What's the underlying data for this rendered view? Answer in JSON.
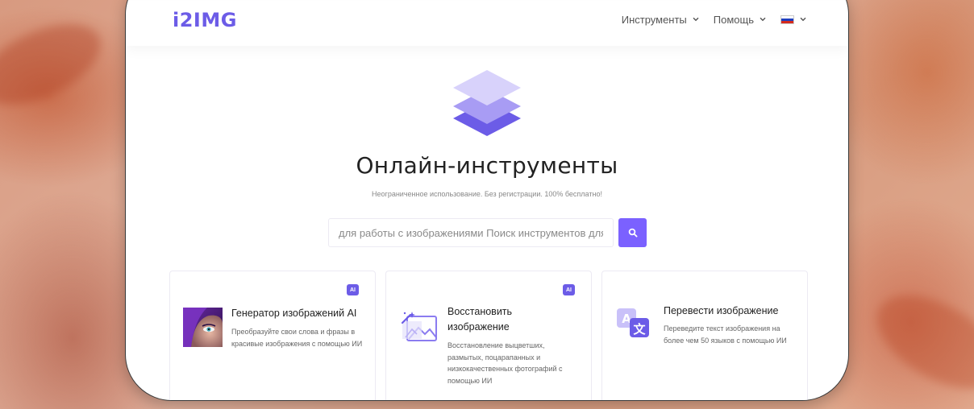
{
  "header": {
    "logo": "i2IMG",
    "nav": [
      {
        "label": "Инструменты"
      },
      {
        "label": "Помощь"
      }
    ],
    "language": "ru"
  },
  "hero": {
    "title": "Онлайн-инструменты",
    "subtitle": "Неограниченное использование. Без регистрации. 100% бесплатно!"
  },
  "search": {
    "placeholder": "для работы с изображениями Поиск инструментов для работы с изображениями"
  },
  "cards": [
    {
      "title": "Генератор изображений AI",
      "desc": "Преобразуйте свои слова и фразы в красивые изображения с помощью ИИ",
      "badge": "AI"
    },
    {
      "title": "Восстановить изображение",
      "desc": "Восстановление выцветших, размытых, поцарапанных и низкокачественных фотографий с помощью ИИ",
      "badge": "AI"
    },
    {
      "title": "Перевести изображение",
      "desc": "Переведите текст изображения на более чем 50 языков с помощью ИИ"
    }
  ],
  "colors": {
    "accent": "#7b61ff",
    "logo": "#6c5ce7"
  }
}
